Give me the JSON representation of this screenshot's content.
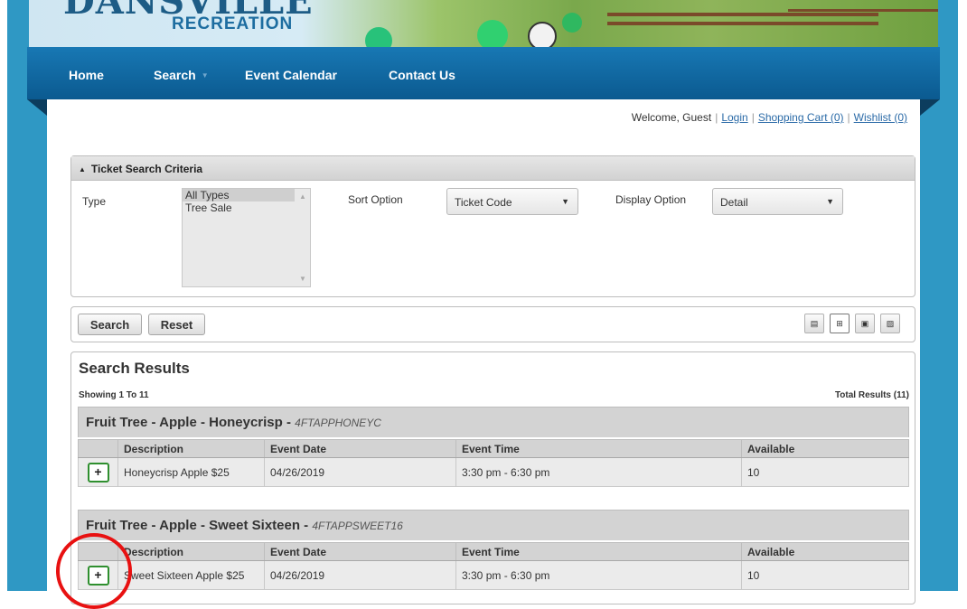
{
  "brand": {
    "partial": "DANSVILLE",
    "subtitle": "RECREATION"
  },
  "nav": {
    "home": "Home",
    "search": "Search",
    "calendar": "Event Calendar",
    "contact": "Contact Us"
  },
  "user_bar": {
    "welcome": "Welcome, Guest",
    "login": "Login",
    "cart": "Shopping Cart (0)",
    "wishlist": "Wishlist (0)"
  },
  "criteria": {
    "title": "Ticket Search Criteria",
    "type_label": "Type",
    "type_options": [
      "All Types",
      "Tree Sale"
    ],
    "sort_label": "Sort Option",
    "sort_value": "Ticket Code",
    "display_label": "Display Option",
    "display_value": "Detail"
  },
  "actions": {
    "search": "Search",
    "reset": "Reset"
  },
  "results": {
    "title": "Search Results",
    "showing": "Showing 1 To 11",
    "total": "Total Results (11)",
    "columns": [
      "Description",
      "Event Date",
      "Event Time",
      "Available"
    ],
    "items": [
      {
        "name": "Fruit Tree - Apple - Honeycrisp - ",
        "code": "4FTAPPHONEYC",
        "description": "Honeycrisp Apple $25",
        "date": "04/26/2019",
        "time": "3:30 pm - 6:30 pm",
        "available": "10"
      },
      {
        "name": "Fruit Tree - Apple - Sweet Sixteen - ",
        "code": "4FTAPPSWEET16",
        "description": "Sweet Sixteen Apple $25",
        "date": "04/26/2019",
        "time": "3:30 pm - 6:30 pm",
        "available": "10"
      }
    ]
  },
  "colors": {
    "accent_blue": "#0b5a90",
    "add_green": "#2f8f2f",
    "annotation_red": "#e81111"
  }
}
